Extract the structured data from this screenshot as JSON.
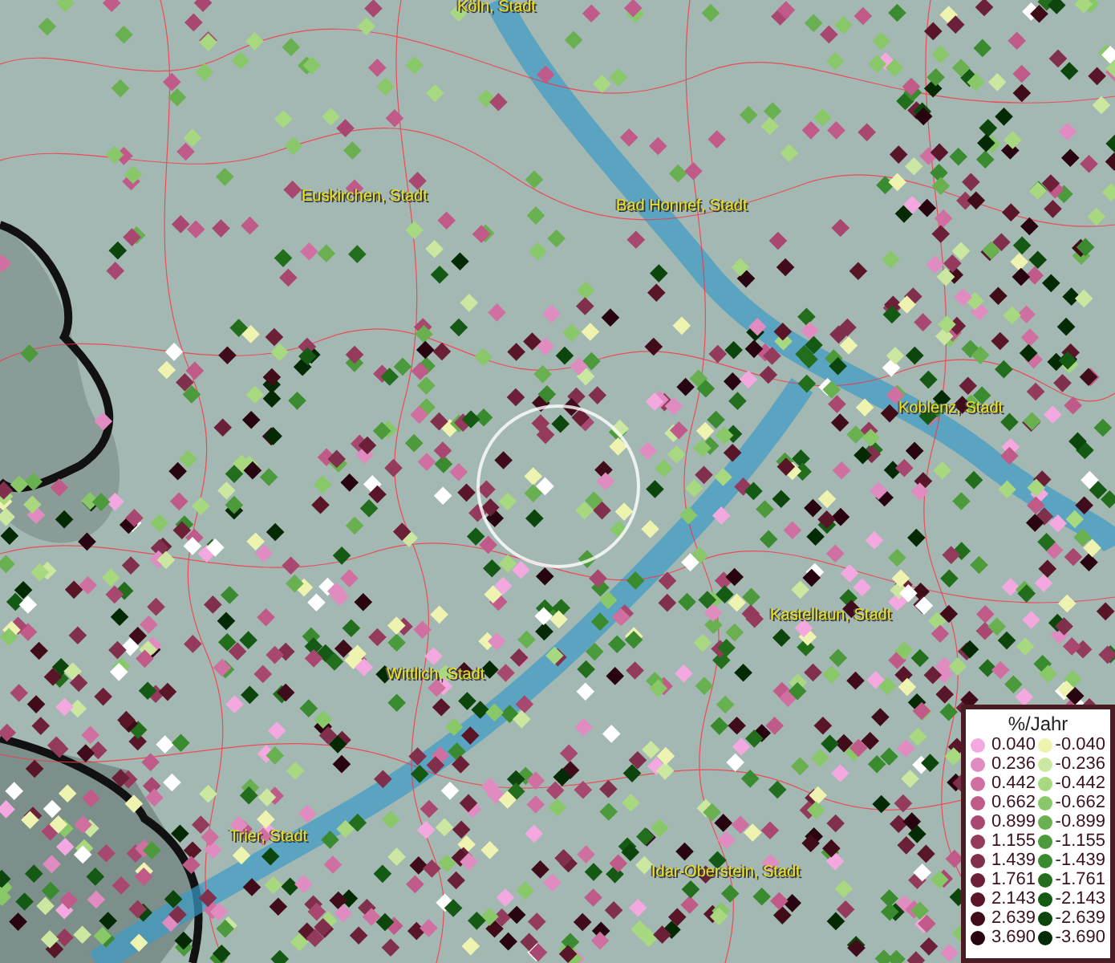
{
  "map": {
    "places": [
      {
        "label": "Köln, Stadt"
      },
      {
        "label": "Euskirchen, Stadt"
      },
      {
        "label": "Bad Honnef, Stadt"
      },
      {
        "label": "Koblenz, Stadt"
      },
      {
        "label": "Kastellaun, Stadt"
      },
      {
        "label": "Wittlich, Stadt"
      },
      {
        "label": "Trier, Stadt"
      },
      {
        "label": "Idar-Oberstein, Stadt"
      }
    ]
  },
  "legend": {
    "title": "%/Jahr",
    "rows": [
      {
        "left": {
          "label": "0.040",
          "color": "#f4a8e0"
        },
        "right": {
          "label": "-0.040",
          "color": "#eef4b0"
        }
      },
      {
        "left": {
          "label": "0.236",
          "color": "#e08cc0"
        },
        "right": {
          "label": "-0.236",
          "color": "#cce8a0"
        }
      },
      {
        "left": {
          "label": "0.442",
          "color": "#d070a0"
        },
        "right": {
          "label": "-0.442",
          "color": "#a8d880"
        }
      },
      {
        "left": {
          "label": "0.662",
          "color": "#c05a88"
        },
        "right": {
          "label": "-0.662",
          "color": "#88c868"
        }
      },
      {
        "left": {
          "label": "0.899",
          "color": "#a84870"
        },
        "right": {
          "label": "-0.899",
          "color": "#68b050"
        }
      },
      {
        "left": {
          "label": "1.155",
          "color": "#943a5c"
        },
        "right": {
          "label": "-1.155",
          "color": "#4c9a3c"
        }
      },
      {
        "left": {
          "label": "1.439",
          "color": "#80304c"
        },
        "right": {
          "label": "-1.439",
          "color": "#3a8a30"
        }
      },
      {
        "left": {
          "label": "1.761",
          "color": "#6c2038"
        },
        "right": {
          "label": "-1.761",
          "color": "#226e1c"
        }
      },
      {
        "left": {
          "label": "2.143",
          "color": "#581628"
        },
        "right": {
          "label": "-2.143",
          "color": "#145a14"
        }
      },
      {
        "left": {
          "label": "2.639",
          "color": "#400c1a"
        },
        "right": {
          "label": "-2.639",
          "color": "#0c460c"
        }
      },
      {
        "left": {
          "label": "3.690",
          "color": "#280410"
        },
        "right": {
          "label": "-3.690",
          "color": "#042a04"
        }
      }
    ]
  }
}
